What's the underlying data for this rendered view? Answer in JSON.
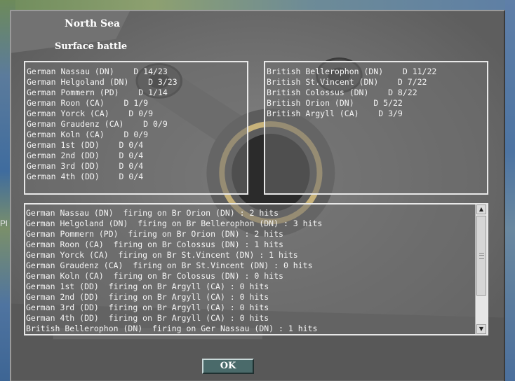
{
  "background": {
    "left_glyph": "Pl"
  },
  "dialog": {
    "title": "North Sea",
    "subtitle": "Surface battle",
    "german_list": [
      "German Nassau (DN)    D 14/23",
      "German Helgoland (DN)    D 3/23",
      "German Pommern (PD)    D 1/14",
      "German Roon (CA)    D 1/9",
      "German Yorck (CA)    D 0/9",
      "German Graudenz (CA)    D 0/9",
      "German Koln (CA)    D 0/9",
      "German 1st (DD)    D 0/4",
      "German 2nd (DD)    D 0/4",
      "German 3rd (DD)    D 0/4",
      "German 4th (DD)    D 0/4"
    ],
    "british_list": [
      "British Bellerophon (DN)    D 11/22",
      "British St.Vincent (DN)    D 7/22",
      "British Colossus (DN)    D 8/22",
      "British Orion (DN)    D 5/22",
      "British Argyll (CA)    D 3/9"
    ],
    "combat_log": [
      "German Nassau (DN)  firing on Br Orion (DN) : 2 hits",
      "German Helgoland (DN)  firing on Br Bellerophon (DN) : 3 hits",
      "German Pommern (PD)  firing on Br Orion (DN) : 2 hits",
      "German Roon (CA)  firing on Br Colossus (DN) : 1 hits",
      "German Yorck (CA)  firing on Br St.Vincent (DN) : 1 hits",
      "German Graudenz (CA)  firing on Br St.Vincent (DN) : 0 hits",
      "German Koln (CA)  firing on Br Colossus (DN) : 0 hits",
      "German 1st (DD)  firing on Br Argyll (CA) : 0 hits",
      "German 2nd (DD)  firing on Br Argyll (CA) : 0 hits",
      "German 3rd (DD)  firing on Br Argyll (CA) : 0 hits",
      "German 4th (DD)  firing on Br Argyll (CA) : 0 hits",
      "British Bellerophon (DN)  firing on Ger Nassau (DN) : 1 hits"
    ],
    "scrollbar": {
      "up_icon": "▲",
      "down_icon": "▼"
    },
    "ok_label": "OK"
  }
}
